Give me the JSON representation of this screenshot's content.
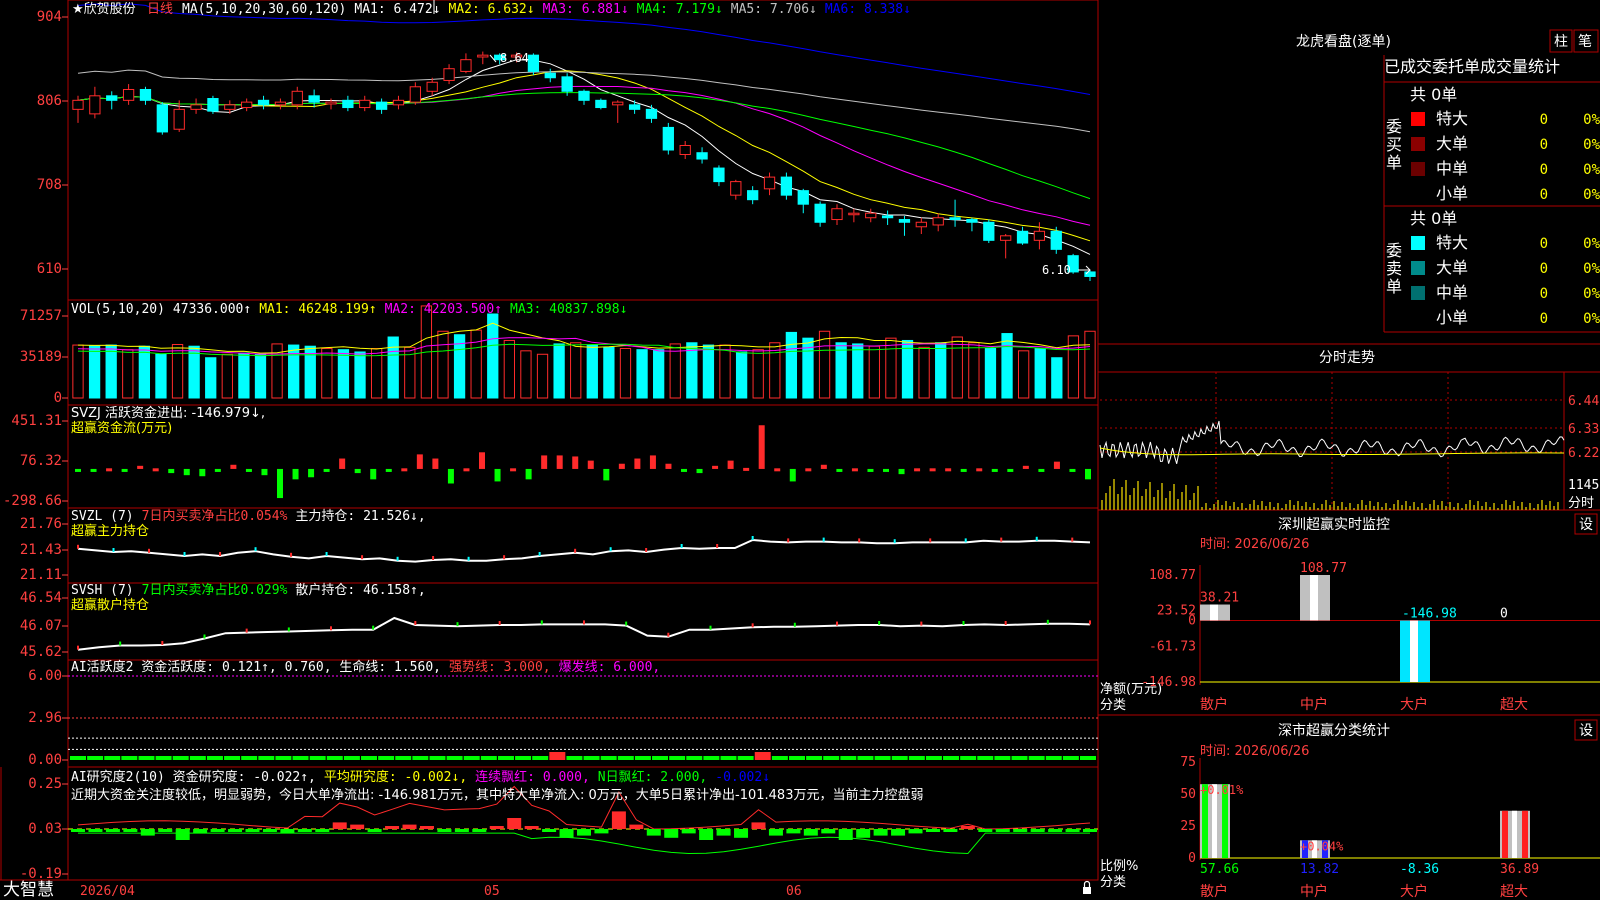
{
  "app": {
    "brand": "大智慧",
    "date_tag": "2026/04",
    "month_labels": [
      "05",
      "06"
    ],
    "colors": {
      "up": "#ff2b2b",
      "down": "#00ffff",
      "grid": "#b00000",
      "label": "#ff4040",
      "ma1": "#ffffff",
      "ma2": "#ffff00",
      "ma3": "#ff00ff",
      "ma4": "#00ff00",
      "ma5": "#c0c0c0",
      "ma6": "#0000ff"
    }
  },
  "price_panel": {
    "stock": "★欣贺股份",
    "period": "日线",
    "legend": [
      {
        "text": "MA(5,10,20,30,60,120)",
        "color": "#ffffff"
      },
      {
        "text": "MA1: 6.472↓",
        "color": "#ffffff"
      },
      {
        "text": "MA2: 6.632↓",
        "color": "#ffff00"
      },
      {
        "text": "MA3: 6.881↓",
        "color": "#ff00ff"
      },
      {
        "text": "MA4: 7.179↓",
        "color": "#00ff00"
      },
      {
        "text": "MA5: 7.706↓",
        "color": "#c0c0c0"
      },
      {
        "text": "MA6: 8.338↓",
        "color": "#0000ff"
      }
    ],
    "y_ticks": [
      "904",
      "806",
      "708",
      "610"
    ],
    "high_label": "8.64",
    "low_label": "6.10"
  },
  "vol_panel": {
    "legend": [
      {
        "text": "VOL(5,10,20)",
        "color": "#ffffff"
      },
      {
        "text": "47336.000↑",
        "color": "#ffffff"
      },
      {
        "text": "MA1: 46248.199↑",
        "color": "#ffff00"
      },
      {
        "text": "MA2: 42203.500↑",
        "color": "#ff00ff"
      },
      {
        "text": "MA3: 40837.898↓",
        "color": "#00ff00"
      }
    ],
    "y_ticks": [
      "71257",
      "35189",
      "0"
    ]
  },
  "svzj_panel": {
    "line1": "SVZJ  活跃资金进出: -146.979↓,",
    "line2": "超赢资金流(万元)",
    "y_ticks": [
      "451.31",
      "76.32",
      "-298.66"
    ]
  },
  "svzl_panel": {
    "legend": [
      {
        "text": "SVZL (7)",
        "color": "#ffffff"
      },
      {
        "text": "7日内买卖净占比0.054%",
        "color": "#ff4040"
      },
      {
        "text": "主力持仓: 21.526↓,",
        "color": "#ffffff"
      }
    ],
    "line2": "超赢主力持仓",
    "y_ticks": [
      "21.76",
      "21.43",
      "21.11"
    ]
  },
  "svsh_panel": {
    "legend": [
      {
        "text": "SVSH (7)",
        "color": "#ffffff"
      },
      {
        "text": "7日内买卖净占比0.029%",
        "color": "#00ff00"
      },
      {
        "text": "散户持仓: 46.158↑,",
        "color": "#ffffff"
      }
    ],
    "line2": "超赢散户持仓",
    "y_ticks": [
      "46.54",
      "46.07",
      "45.62"
    ]
  },
  "ai_active_panel": {
    "legend": [
      {
        "text": "AI活跃度2 资金活跃度: 0.121↑, 0.760, 生命线: 1.560,",
        "color": "#ffffff"
      },
      {
        "text": "强势线: 3.000,",
        "color": "#ff4040"
      },
      {
        "text": "爆发线: 6.000,",
        "color": "#ff00ff"
      }
    ],
    "y_ticks": [
      "6.00",
      "2.96",
      "0.00"
    ]
  },
  "ai_research_panel": {
    "legend": [
      {
        "text": "AI研究度2(10) 资金研究度: -0.022↑,",
        "color": "#ffffff"
      },
      {
        "text": "平均研究度: -0.002↓,",
        "color": "#ffff00"
      },
      {
        "text": "连续飘红: 0.000,",
        "color": "#ff00ff"
      },
      {
        "text": "N日飘红: 2.000,",
        "color": "#00ff00"
      },
      {
        "text": "-0.002↓",
        "color": "#0000ff"
      }
    ],
    "comment": "近期大资金关注度较低，明显弱势，今日大单净流出: -146.981万元，其中特大单净流入: 0万元，大单5日累计净出-101.483万元，当前主力控盘弱",
    "y_ticks": [
      "0.25",
      "0.03",
      "-0.19"
    ]
  },
  "lhb": {
    "title": "龙虎看盘(逐单)",
    "btn_bar": "柱",
    "btn_pen": "笔",
    "header": "已成交委托单成交量统计",
    "buy": {
      "label": "委买单",
      "total": "共 0单",
      "rows": [
        {
          "name": "特大",
          "count": "0",
          "pct": "0%",
          "color": "#ff0000"
        },
        {
          "name": "大单",
          "count": "0",
          "pct": "0%",
          "color": "#8b0000"
        },
        {
          "name": "中单",
          "count": "0",
          "pct": "0%",
          "color": "#6b0000"
        },
        {
          "name": "小单",
          "count": "0",
          "pct": "0%",
          "color": ""
        }
      ]
    },
    "sell": {
      "label": "委卖单",
      "total": "共 0单",
      "rows": [
        {
          "name": "特大",
          "count": "0",
          "pct": "0%",
          "color": "#00ffff"
        },
        {
          "name": "大单",
          "count": "0",
          "pct": "0%",
          "color": "#008b8b"
        },
        {
          "name": "中单",
          "count": "0",
          "pct": "0%",
          "color": "#007070"
        },
        {
          "name": "小单",
          "count": "0",
          "pct": "0%",
          "color": ""
        }
      ]
    }
  },
  "minute": {
    "title": "分时走势",
    "y_ticks": [
      "6.44",
      "6.33",
      "6.22"
    ],
    "vol_tick": "1145",
    "unit": "分时"
  },
  "monitor": {
    "title": "深圳超赢实时监控",
    "set": "设",
    "time": "时间: 2026/06/26",
    "y_ticks": [
      "108.77",
      "23.52",
      "0",
      "-61.73",
      "-146.98"
    ],
    "ylabel1": "净额(万元)",
    "ylabel2": "分类",
    "categories": [
      "散户",
      "中户",
      "大户",
      "超大"
    ]
  },
  "classify": {
    "title": "深市超赢分类统计",
    "set": "设",
    "time": "时间: 2026/06/26",
    "y_ticks": [
      "75",
      "50",
      "25",
      "0"
    ],
    "ylabel1": "比例%",
    "ylabel2": "分类",
    "categories": [
      "散户",
      "中户",
      "大户",
      "超大"
    ]
  },
  "chart_data": [
    {
      "type": "candlestick",
      "title": "欣贺股份 日线",
      "ylim": [
        6.0,
        9.1
      ],
      "x_ticks": [
        "2026/04",
        "05",
        "06"
      ],
      "candles": [
        [
          8.0,
          8.1,
          7.85,
          8.15
        ],
        [
          7.95,
          8.15,
          7.9,
          8.25
        ],
        [
          8.15,
          8.1,
          8.0,
          8.2
        ],
        [
          8.1,
          8.22,
          8.05,
          8.28
        ],
        [
          8.22,
          8.1,
          8.05,
          8.25
        ],
        [
          8.05,
          7.75,
          7.72,
          8.08
        ],
        [
          7.78,
          8.0,
          7.75,
          8.1
        ],
        [
          8.0,
          8.05,
          7.95,
          8.12
        ],
        [
          8.12,
          7.98,
          7.95,
          8.15
        ],
        [
          8.0,
          8.05,
          7.95,
          8.1
        ],
        [
          8.02,
          8.08,
          7.98,
          8.12
        ],
        [
          8.1,
          8.05,
          8.0,
          8.15
        ],
        [
          8.05,
          8.08,
          8.0,
          8.12
        ],
        [
          8.05,
          8.2,
          8.0,
          8.25
        ],
        [
          8.15,
          8.08,
          8.02,
          8.22
        ],
        [
          8.06,
          8.08,
          8.0,
          8.12
        ],
        [
          8.1,
          8.02,
          7.98,
          8.15
        ],
        [
          8.02,
          8.1,
          7.98,
          8.15
        ],
        [
          8.08,
          8.0,
          7.95,
          8.12
        ],
        [
          8.05,
          8.1,
          8.0,
          8.15
        ],
        [
          8.08,
          8.25,
          8.05,
          8.3
        ],
        [
          8.2,
          8.3,
          8.15,
          8.35
        ],
        [
          8.32,
          8.45,
          8.28,
          8.5
        ],
        [
          8.42,
          8.55,
          8.4,
          8.62
        ],
        [
          8.58,
          8.6,
          8.5,
          8.64
        ],
        [
          8.6,
          8.55,
          8.5,
          8.62
        ],
        [
          8.58,
          8.6,
          8.52,
          8.63
        ],
        [
          8.6,
          8.42,
          8.38,
          8.62
        ],
        [
          8.4,
          8.35,
          8.3,
          8.45
        ],
        [
          8.36,
          8.2,
          8.15,
          8.4
        ],
        [
          8.2,
          8.1,
          8.05,
          8.22
        ],
        [
          8.1,
          8.02,
          8.0,
          8.12
        ],
        [
          8.05,
          8.08,
          7.85,
          8.1
        ],
        [
          8.05,
          8.0,
          7.95,
          8.1
        ],
        [
          8.0,
          7.9,
          7.85,
          8.05
        ],
        [
          7.8,
          7.55,
          7.5,
          7.85
        ],
        [
          7.5,
          7.6,
          7.45,
          7.65
        ],
        [
          7.52,
          7.45,
          7.4,
          7.58
        ],
        [
          7.35,
          7.2,
          7.15,
          7.38
        ],
        [
          7.05,
          7.2,
          7.0,
          7.22
        ],
        [
          7.1,
          7.0,
          6.95,
          7.15
        ],
        [
          7.12,
          7.25,
          7.05,
          7.3
        ],
        [
          7.25,
          7.05,
          7.0,
          7.3
        ],
        [
          7.1,
          6.95,
          6.85,
          7.12
        ],
        [
          6.95,
          6.75,
          6.7,
          6.98
        ],
        [
          6.78,
          6.9,
          6.72,
          6.95
        ],
        [
          6.85,
          6.85,
          6.75,
          6.9
        ],
        [
          6.8,
          6.85,
          6.75,
          6.9
        ],
        [
          6.82,
          6.8,
          6.72,
          6.88
        ],
        [
          6.78,
          6.75,
          6.6,
          6.82
        ],
        [
          6.7,
          6.75,
          6.62,
          6.8
        ],
        [
          6.72,
          6.8,
          6.65,
          6.85
        ],
        [
          6.8,
          6.78,
          6.7,
          7.0
        ],
        [
          6.78,
          6.75,
          6.65,
          6.8
        ],
        [
          6.75,
          6.55,
          6.52,
          6.78
        ],
        [
          6.55,
          6.6,
          6.35,
          6.62
        ],
        [
          6.65,
          6.52,
          6.5,
          6.7
        ],
        [
          6.55,
          6.65,
          6.45,
          6.75
        ],
        [
          6.65,
          6.45,
          6.4,
          6.7
        ],
        [
          6.38,
          6.2,
          6.18,
          6.4
        ],
        [
          6.2,
          6.15,
          6.1,
          6.22
        ]
      ]
    },
    {
      "type": "bar",
      "title": "VOL(5,10,20)",
      "ylim": [
        0,
        71257
      ],
      "values": [
        46000,
        45500,
        46000,
        42000,
        45000,
        38000,
        46500,
        45000,
        35000,
        38000,
        39000,
        38000,
        47000,
        46000,
        45000,
        43000,
        42000,
        40000,
        43000,
        53000,
        44000,
        80000,
        58000,
        55000,
        59000,
        73000,
        50000,
        41000,
        38000,
        47000,
        48000,
        46000,
        44000,
        43000,
        42000,
        42000,
        47000,
        48000,
        46000,
        46000,
        40000,
        42000,
        48000,
        57000,
        52000,
        58000,
        48000,
        47000,
        45000,
        52000,
        50000,
        44000,
        48000,
        53000,
        48000,
        43000,
        56000,
        41000,
        43000,
        35000,
        54000,
        58000
      ]
    },
    {
      "type": "bar",
      "title": "SVZJ 超赢资金流(万元)",
      "ylim": [
        -298.66,
        451.31
      ],
      "values": [
        -20,
        -10,
        0,
        -20,
        30,
        0,
        -40,
        -60,
        -70,
        -20,
        40,
        -10,
        -60,
        -280,
        -100,
        -80,
        -20,
        100,
        -40,
        -100,
        -20,
        0,
        140,
        100,
        -140,
        0,
        160,
        -120,
        0,
        -100,
        130,
        130,
        120,
        80,
        -110,
        50,
        100,
        130,
        50,
        -20,
        -40,
        30,
        80,
        10,
        420,
        0,
        -120,
        0,
        40,
        -10,
        0,
        -10,
        -10,
        -50,
        0,
        0,
        0,
        -20,
        0,
        -20,
        -10,
        30,
        -10,
        70,
        -20,
        -100
      ]
    },
    {
      "type": "line",
      "title": "SVZL 主力持仓",
      "ylim": [
        21.11,
        21.76
      ],
      "values": [
        21.45,
        21.43,
        21.41,
        21.42,
        21.4,
        21.38,
        21.36,
        21.38,
        21.36,
        21.4,
        21.42,
        21.38,
        21.35,
        21.33,
        21.36,
        21.34,
        21.32,
        21.33,
        21.3,
        21.29,
        21.31,
        21.32,
        21.3,
        21.3,
        21.32,
        21.33,
        21.36,
        21.38,
        21.4,
        21.38,
        21.42,
        21.43,
        21.41,
        21.44,
        21.46,
        21.45,
        21.46,
        21.46,
        21.56,
        21.54,
        21.53,
        21.54,
        21.54,
        21.53,
        21.53,
        21.52,
        21.52,
        21.53,
        21.53,
        21.53,
        21.53,
        21.55,
        21.54,
        21.54,
        21.55,
        21.55,
        21.54,
        21.53
      ]
    },
    {
      "type": "line",
      "title": "SVSH 散户持仓",
      "ylim": [
        45.62,
        46.54
      ],
      "values": [
        45.66,
        45.7,
        45.73,
        45.73,
        45.74,
        45.77,
        45.85,
        45.94,
        45.95,
        45.96,
        45.97,
        45.98,
        45.99,
        46.0,
        46.0,
        46.2,
        46.08,
        46.07,
        46.06,
        46.07,
        46.08,
        46.08,
        46.09,
        46.09,
        46.09,
        46.09,
        46.07,
        45.9,
        45.88,
        46.0,
        46.0,
        46.02,
        46.04,
        46.05,
        46.05,
        46.06,
        46.07,
        46.08,
        46.08,
        46.06,
        46.07,
        46.06,
        46.08,
        46.09,
        46.08,
        46.09,
        46.1,
        46.1,
        46.09
      ]
    },
    {
      "type": "bar",
      "title": "AI活跃度2",
      "ylim": [
        0,
        6
      ],
      "values": [
        0.3,
        0.25,
        0.3,
        0.2,
        0.2,
        0.3,
        0.25,
        0.3,
        0.25,
        0.3,
        0.3,
        0.3,
        0.3,
        0.3,
        0.3,
        0.3,
        0.3,
        0.3,
        0.3,
        0.3,
        0.3,
        0.3,
        0.3,
        0.3,
        0.3,
        0.3,
        0.3,
        0.3,
        0.3,
        0.3,
        0.3,
        0.3,
        0.3,
        0.3,
        0.3,
        0.3,
        0.3,
        0.3,
        0.3,
        0.3,
        0.3,
        0.3,
        0.3,
        0.3,
        0.3,
        0.3,
        0.3,
        0.3,
        0.3,
        0.3,
        0.3,
        0.3,
        0.3,
        0.3,
        0.3,
        0.3,
        0.3,
        0.3,
        0.3,
        0.3
      ]
    },
    {
      "type": "bar",
      "title": "AI研究度2(10)",
      "ylim": [
        -0.19,
        0.25
      ],
      "values": [
        0,
        0,
        -0.01,
        0,
        -0.03,
        -0.01,
        -0.05,
        -0.02,
        -0.01,
        0,
        -0.01,
        -0.01,
        -0.02,
        -0.01,
        0,
        0.03,
        0.02,
        -0.01,
        0.01,
        0.02,
        0.01,
        0,
        -0.01,
        -0.01,
        0.01,
        0.05,
        0.01,
        0,
        -0.04,
        -0.03,
        -0.02,
        0.08,
        0.02,
        -0.03,
        -0.04,
        -0.02,
        -0.05,
        -0.03,
        -0.04,
        0.03,
        -0.03,
        -0.02,
        -0.03,
        -0.02,
        -0.05,
        -0.04,
        -0.03,
        -0.03,
        -0.02,
        -0.01,
        0,
        0.01,
        0,
        0,
        -0.01,
        0,
        0,
        -0.01,
        -0.01
      ]
    },
    {
      "type": "bar",
      "title": "深圳超赢实时监控",
      "xlabel": "分类",
      "ylabel": "净额(万元)",
      "categories": [
        "散户",
        "中户",
        "大户",
        "超大"
      ],
      "values": [
        38.21,
        108.77,
        -146.98,
        0
      ],
      "ylim": [
        -146.98,
        108.77
      ]
    },
    {
      "type": "bar",
      "title": "深市超赢分类统计",
      "xlabel": "分类",
      "ylabel": "比例%",
      "categories": [
        "散户",
        "中户",
        "大户",
        "超大"
      ],
      "values": [
        57.66,
        13.82,
        -8.36,
        36.89
      ],
      "change": [
        "+0.01%",
        "+0.04%",
        "",
        ""
      ],
      "ylim": [
        0,
        75
      ]
    }
  ]
}
